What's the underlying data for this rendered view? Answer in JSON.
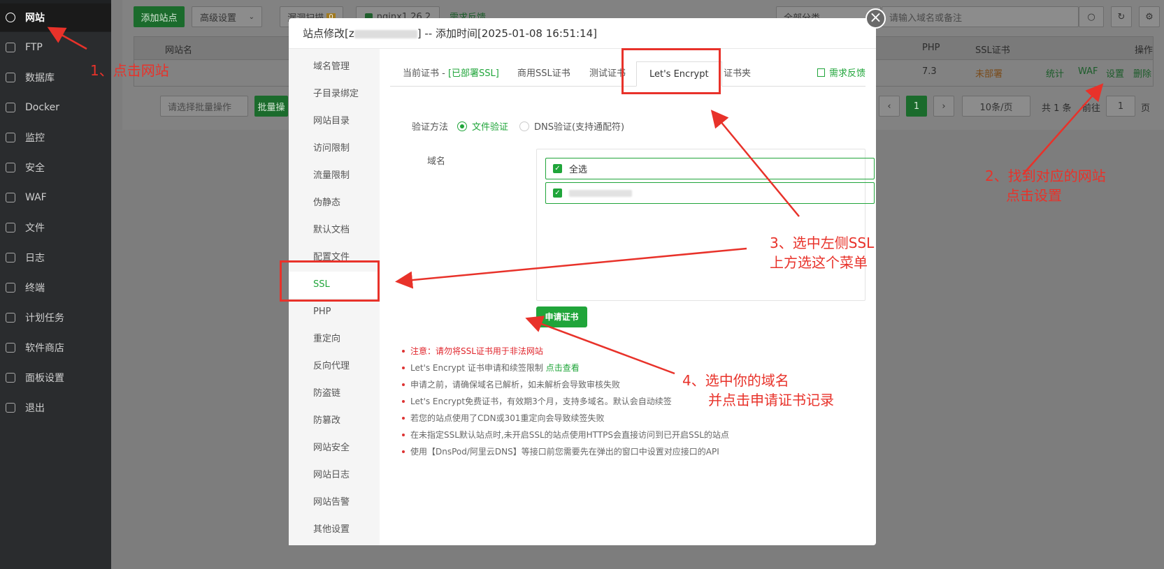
{
  "sidebar": {
    "items": [
      {
        "label": "网站"
      },
      {
        "label": "FTP"
      },
      {
        "label": "数据库"
      },
      {
        "label": "Docker"
      },
      {
        "label": "监控"
      },
      {
        "label": "安全"
      },
      {
        "label": "WAF"
      },
      {
        "label": "文件"
      },
      {
        "label": "日志"
      },
      {
        "label": "终端"
      },
      {
        "label": "计划任务"
      },
      {
        "label": "软件商店"
      },
      {
        "label": "面板设置"
      },
      {
        "label": "退出"
      }
    ]
  },
  "toolbar": {
    "add_site": "添加站点",
    "advanced": "高级设置",
    "vuln_scan": "漏洞扫描",
    "vuln_count": "0",
    "nginx": "nginx1.26.2",
    "feedback": "需求反馈",
    "category": "全部分类",
    "search_placeholder": "请输入域名或备注"
  },
  "table": {
    "headers": {
      "name": "网站名",
      "php": "PHP",
      "ssl": "SSL证书",
      "actions": "操作"
    },
    "row": {
      "php": "7.3",
      "ssl": "未部署",
      "actions": [
        "统计",
        "WAF",
        "设置",
        "删除"
      ]
    },
    "footer": {
      "batch_placeholder": "请选择批量操作",
      "batch_button": "批量操",
      "page": "1",
      "per_page": "10条/页",
      "total": "共 1 条",
      "goto": "前往",
      "goto_page": "1",
      "page_suffix": "页"
    }
  },
  "modal": {
    "title": "站点修改[z",
    "title_added": "] -- 添加时间[2025-01-08 16:51:14]",
    "nav": [
      "域名管理",
      "子目录绑定",
      "网站目录",
      "访问限制",
      "流量限制",
      "伪静态",
      "默认文档",
      "配置文件",
      "SSL",
      "PHP",
      "重定向",
      "反向代理",
      "防盗链",
      "防篡改",
      "网站安全",
      "网站日志",
      "网站告警",
      "其他设置"
    ],
    "active_nav": "SSL",
    "tabs": {
      "current_prefix": "当前证书 - ",
      "current_status": "[已部署SSL]",
      "commercial": "商用SSL证书",
      "test": "测试证书",
      "letsencrypt": "Let's Encrypt",
      "folder": "证书夹",
      "feedback": "需求反馈"
    },
    "verify_label": "验证方法",
    "verify_file": "文件验证",
    "verify_dns": "DNS验证(支持通配符)",
    "domain_label": "域名",
    "select_all": "全选",
    "apply_button": "申请证书",
    "tips": [
      "注意：请勿将SSL证书用于非法网站",
      "Let's Encrypt 证书申请和续签限制 ",
      "申请之前，请确保域名已解析，如未解析会导致审核失败",
      "Let's Encrypt免费证书，有效期3个月，支持多域名。默认会自动续签",
      "若您的站点使用了CDN或301重定向会导致续签失败",
      "在未指定SSL默认站点时,未开启SSL的站点使用HTTPS会直接访问到已开启SSL的站点",
      "使用【DnsPod/阿里云DNS】等接口前您需要先在弹出的窗口中设置对应接口的API"
    ],
    "tip_link": "点击查看"
  },
  "annotations": {
    "a1": "1、点击网站",
    "a2_line1": "2、找到对应的网站",
    "a2_line2": "点击设置",
    "a3_line1": "3、选中左侧SSL",
    "a3_line2": "上方选这个菜单",
    "a4_line1": "4、选中你的域名",
    "a4_line2": "并点击申请证书记录",
    "color": "#e8322a"
  }
}
